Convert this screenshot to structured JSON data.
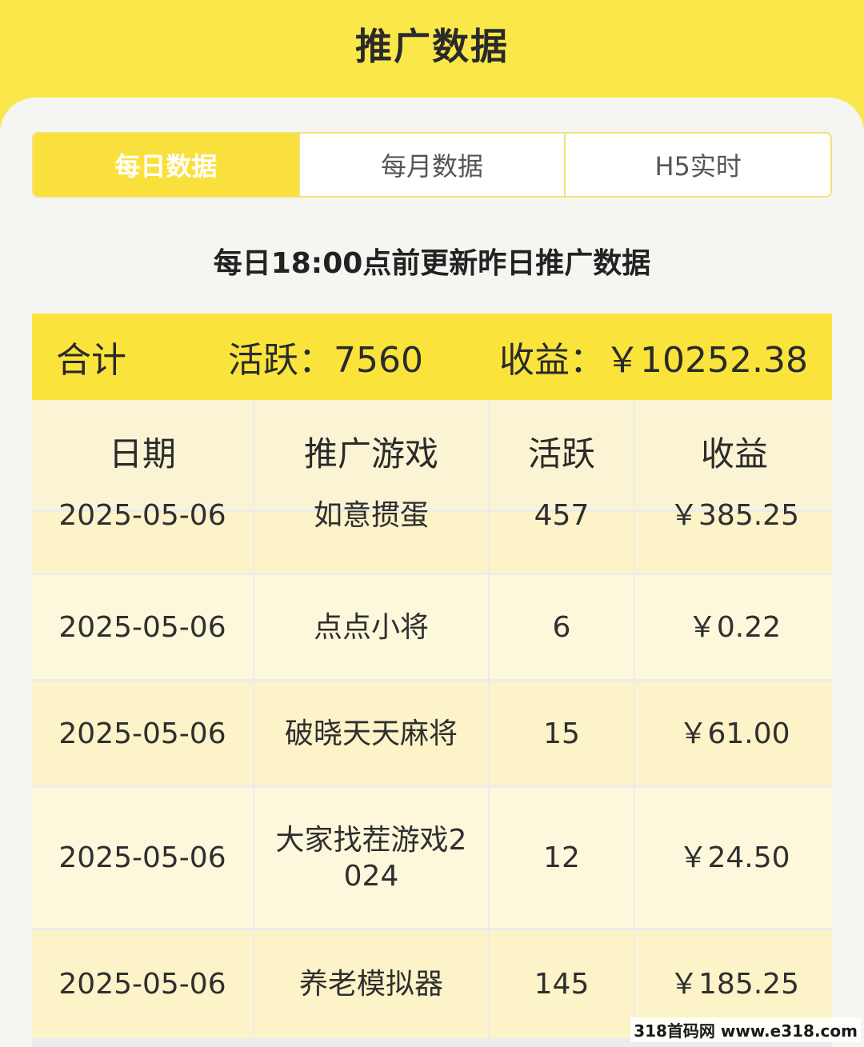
{
  "header": {
    "title": "推广数据"
  },
  "tabs": [
    {
      "label": "每日数据",
      "active": true
    },
    {
      "label": "每月数据",
      "active": false
    },
    {
      "label": "H5实时",
      "active": false
    }
  ],
  "notice": "每日18:00点前更新昨日推广数据",
  "summary": {
    "total_label": "合计",
    "active_text": "活跃：7560",
    "income_text": "收益：￥10252.38"
  },
  "table": {
    "columns": [
      "日期",
      "推广游戏",
      "活跃",
      "收益"
    ],
    "rows": [
      {
        "date": "2025-05-06",
        "game": "如意掼蛋",
        "active": "457",
        "income": "￥385.25"
      },
      {
        "date": "2025-05-06",
        "game": "点点小将",
        "active": "6",
        "income": "￥0.22"
      },
      {
        "date": "2025-05-06",
        "game": "破晓天天麻将",
        "active": "15",
        "income": "￥61.00"
      },
      {
        "date": "2025-05-06",
        "game": "大家找茬游戏2024",
        "active": "12",
        "income": "￥24.50"
      },
      {
        "date": "2025-05-06",
        "game": "养老模拟器",
        "active": "145",
        "income": "￥185.25"
      }
    ]
  },
  "watermark": "318首码网 www.e318.com"
}
